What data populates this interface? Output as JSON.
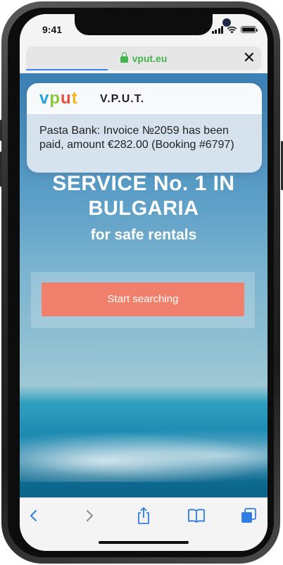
{
  "status_bar": {
    "time": "9:41"
  },
  "browser": {
    "url": "vput.eu",
    "close_symbol": "✕"
  },
  "hero": {
    "heading_line1": "SERVICE No. 1 IN",
    "heading_line2": "BULGARIA",
    "subheading": "for safe rentals",
    "search_button": "Start searching"
  },
  "notification": {
    "logo": {
      "v": "v",
      "p": "p",
      "u": "u",
      "t": "t"
    },
    "app_name": "V.P.U.T.",
    "message": "Pasta Bank: Invoice №2059 has been paid, amount €282.00 (Booking #6797)"
  },
  "toolbar": {
    "back_icon": "chevron-left-icon",
    "forward_icon": "chevron-right-icon",
    "share_icon": "share-icon",
    "bookmarks_icon": "book-icon",
    "tabs_icon": "tabs-icon"
  },
  "colors": {
    "accent_blue": "#3b82f6",
    "url_green": "#44b34a",
    "button_coral": "#f0806b"
  }
}
